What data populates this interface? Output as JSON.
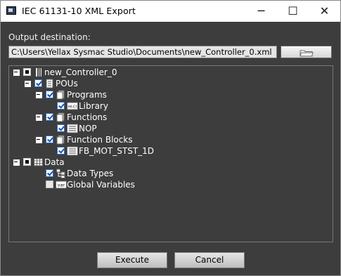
{
  "window": {
    "title": "IEC 61131-10 XML Export",
    "controls": {
      "minimize": "─",
      "maximize": "☐",
      "close": "✕"
    }
  },
  "output": {
    "label": "Output destination:",
    "path": "C:\\Users\\Yellax Sysmac Studio\\Documents\\new_Controller_0.xml"
  },
  "tree": {
    "root": "new_Controller_0",
    "pous": "POUs",
    "programs": "Programs",
    "library": "Library",
    "functions": "Functions",
    "nop": "NOP",
    "function_blocks": "Function Blocks",
    "fb_mot": "FB_MOT_STST_1D",
    "data": "Data",
    "data_types": "Data Types",
    "global_variables": "Global Variables",
    "var_icon_text": "var",
    "lib_icon_text": "HI-CI"
  },
  "buttons": {
    "execute": "Execute",
    "cancel": "Cancel"
  },
  "colors": {
    "body_bg": "#3d3d3d",
    "check_blue": "#2e6fc2"
  }
}
